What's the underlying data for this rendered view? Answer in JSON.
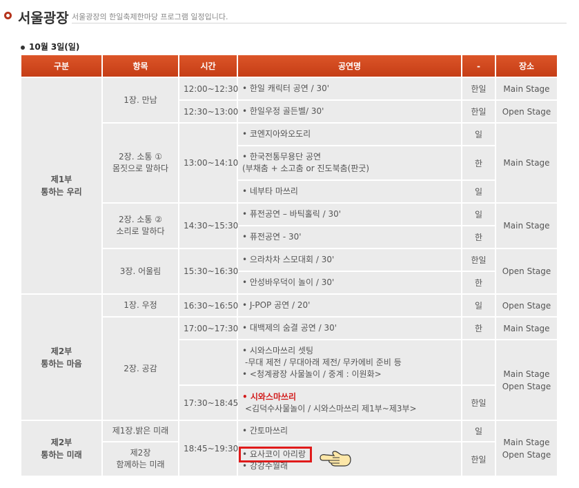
{
  "header": {
    "title": "서울광장",
    "desc": "서울광장의 한일축제한마당 프로그램 일정입니다."
  },
  "date": "10월 3일(일)",
  "columns": [
    "구분",
    "항목",
    "시간",
    "공연명",
    "-",
    "장소"
  ],
  "rows": {
    "part1": "제1부\n통하는 우리",
    "part2": "제2부\n통하는 마음",
    "part3": "제2부\n통하는 미래",
    "item1": "1장. 만남",
    "item2a": "2장. 소통 ①",
    "item2b": "몸짓으로 말하다",
    "item3a": "2장. 소통 ②",
    "item3b": "소리로 말하다",
    "item4": "3장. 어울림",
    "item5": "1장. 우정",
    "item6": "2장. 공감",
    "item7": "제1장.밝은 미래",
    "item8a": "제2장",
    "item8b": "함께하는 미래",
    "t1": "12:00~12:30",
    "t2": "12:30~13:00",
    "t3": "13:00~14:10",
    "t4": "14:30~15:30",
    "t5": "15:30~16:30",
    "t6": "16:30~16:50",
    "t7": "17:00~17:30",
    "t8": "17:30~18:45",
    "t9": "18:45~19:30",
    "p1": "• 한일 캐릭터 공연 / 30'",
    "p2": "• 한일우정 골든벨/ 30'",
    "p3": "• 코엔지아와오도리",
    "p4a": "• 한국전통무용단 공연",
    "p4b": "(부채춤 + 소고춤 or 진도북춤(판굿)",
    "p5": "• 네부타 마쓰리",
    "p6": "• 퓨전공연 – 바틱홀릭 / 30'",
    "p7": "• 퓨전공연 - 30'",
    "p8": "• 으라차차 스모대회 / 30'",
    "p9": "• 안성바우덕이 놀이 / 30'",
    "p10": "• J-POP 공연 / 20'",
    "p11": "• 대백제의 숨결 공연 / 30'",
    "p12a": "• 시와스마쓰리 셋팅",
    "p12b": "-무대 제전 / 무대아래 제전/ 무카에비 준비 등",
    "p12c": "• <청계광장 사물놀이 / 중계 : 이원화>",
    "p13a": "• 시와스마쓰리",
    "p13b": "<김덕수사물놀이 / 시와스마쓰리 제1부~제3부>",
    "p14": "• 간토마쓰리",
    "p15": "• 요사코이 아리랑",
    "p16": "• 강강수월래",
    "l1": "한일",
    "l2": "한일",
    "l3": "일",
    "l4": "한",
    "l5": "일",
    "l6": "일",
    "l7": "한",
    "l8": "한일",
    "l9": "한",
    "l10": "일",
    "l11": "한",
    "l12": "한일",
    "l13": "일",
    "l14": "한일",
    "s1": "Main Stage",
    "s2": "Open Stage",
    "s3": "Main Stage",
    "s4": "Main Stage",
    "s5": "Open Stage",
    "s6": "Open Stage",
    "s7": "Main Stage",
    "s8a": "Main Stage",
    "s8b": "Open Stage",
    "s9a": "Main Stage",
    "s9b": "Open Stage"
  },
  "colors": {
    "header_bg": "#d3471d",
    "cell_bg": "#ebebeb",
    "highlight": "#e01a1a",
    "red_text": "#d21a1a"
  },
  "icons": {
    "bullet": "circle-bullet-icon",
    "hand": "pointing-hand-icon"
  }
}
